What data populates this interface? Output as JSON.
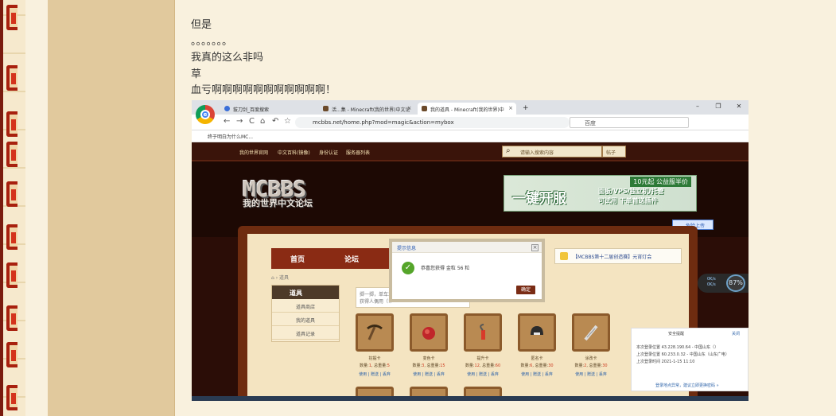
{
  "post": {
    "lines": [
      "但是",
      "。。。。。。。",
      "我真的这么非吗",
      "草",
      "血亏啊啊啊啊啊啊啊啊啊啊啊！"
    ]
  },
  "screenshot": {
    "browser": {
      "tabs": [
        {
          "label": "拔刀剑_百度搜索",
          "active": false
        },
        {
          "label": "活...集 - Minecraft(我的世界)中文论",
          "active": false
        },
        {
          "label": "我的道具 - Minecraft(我的世界)中",
          "active": true
        }
      ],
      "new_tab_label": "+",
      "window_buttons": [
        "–",
        "❐",
        "✕"
      ],
      "nav_icons": [
        "←",
        "→",
        "C",
        "⌂",
        "↶",
        "☆"
      ],
      "url": "mcbbs.net/home.php?mod=magic&action=mybox",
      "search_engine_placeholder": "百度",
      "bookmark": "终于明白为什么MC..."
    },
    "site": {
      "nav_links": [
        "我的世界官网",
        "中文百科(镜像)",
        "身份认证",
        "服务器列表"
      ],
      "search_placeholder": "请输入搜索内容",
      "search_scope": "帖子",
      "logo_text": "MCBBS",
      "logo_subtitle": "我的世界中文论坛",
      "banner": {
        "tag": "10元起 公益服半价",
        "big": "一键开服",
        "line1": "面板/VPS/独立机/托管",
        "line2": "可试用 下单首送插件"
      },
      "upload_button": "危险上传",
      "main_nav": [
        "首页",
        "论坛"
      ],
      "breadcrumb": "道具",
      "side_menu": {
        "title": "道具",
        "items": [
          "道具商店",
          "我的道具",
          "道具记录"
        ]
      },
      "hint_box": [
        "掷一掷，单车3",
        "获得人偶用（!）"
      ],
      "dialog": {
        "title": "提示信息",
        "message": "恭喜您获得 金粒 56 粒",
        "ok_label": "确定",
        "close_label": "×"
      },
      "notice": "【MCBBS第十二届创造赛】元宵灯会",
      "cards": [
        {
          "name": "挖掘卡",
          "count": "1",
          "weight": "5"
        },
        {
          "name": "变色卡",
          "count": "3",
          "weight": "15"
        },
        {
          "name": "提升卡",
          "count": "12",
          "weight": "60"
        },
        {
          "name": "匿名卡",
          "count": "6",
          "weight": "30"
        },
        {
          "name": "涂改卡",
          "count": "2",
          "weight": "30"
        }
      ],
      "card_labels": {
        "count": "数量:",
        "weight": "总重量:",
        "use": "使用",
        "gift": "赠送",
        "sell": "丢弃"
      },
      "security": {
        "title": "安全提醒",
        "close": "关闭",
        "lines": [
          "本次登录位置 43.228.190.64 - 中国山东（）",
          "上次登录位置 60.233.0.32 - 中国山东（山东广电）",
          "上次登录时间 2021-1-15 11:10"
        ],
        "footer": "登录地点异常，建议立即更换密码 »"
      },
      "speed_widget": {
        "percent": "87%",
        "up": "0K/s",
        "down": "0K/s"
      }
    },
    "colors": {
      "site_nav_bg": "#3a140a",
      "panel_bg": "#f4e4c1",
      "main_nav_bg": "#8a2b14",
      "card_border": "#8b5a2b",
      "accent_red": "#cc3a1f",
      "link_blue": "#2d63a9"
    }
  }
}
